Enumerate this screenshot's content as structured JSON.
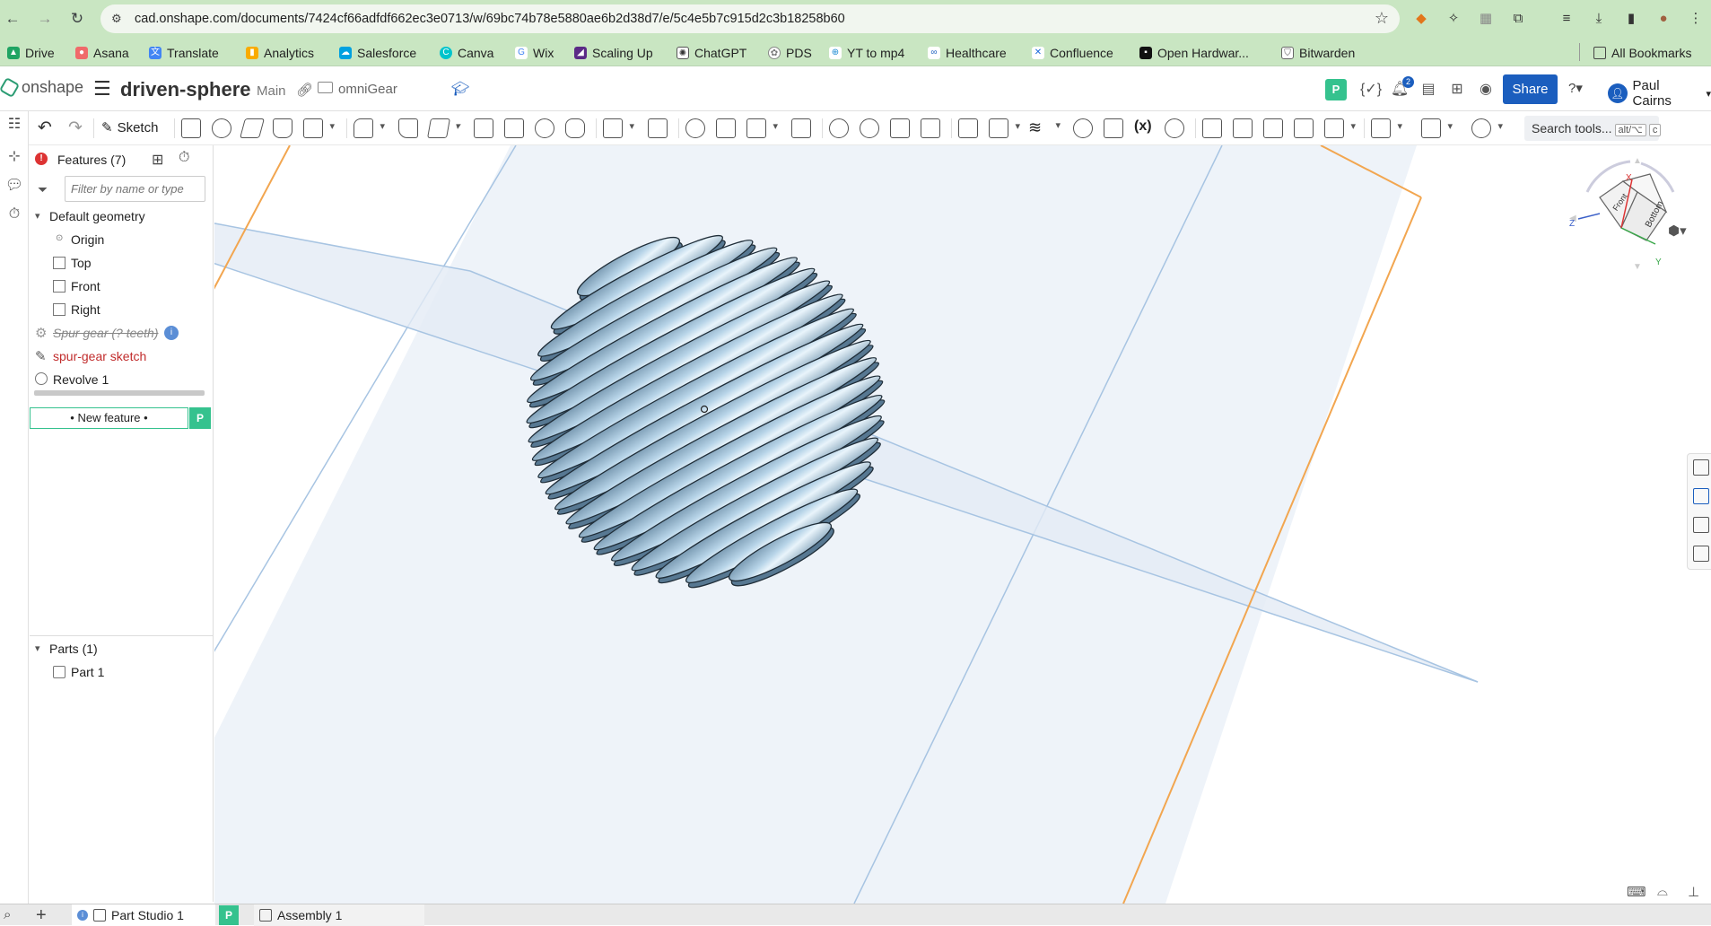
{
  "browser": {
    "url": "cad.onshape.com/documents/7424cf66adfdf662ec3e0713/w/69bc74b78e5880ae6b2d38d7/e/5c4e5b7c915d2c3b18258b60",
    "bookmarks": [
      "Drive",
      "Asana",
      "Translate",
      "Analytics",
      "Salesforce",
      "Canva",
      "Wix",
      "Scaling Up",
      "ChatGPT",
      "PDS",
      "YT to mp4",
      "Healthcare",
      "Confluence",
      "Open Hardwar...",
      "Bitwarden"
    ],
    "all_bookmarks": "All Bookmarks"
  },
  "header": {
    "logo": "onshape",
    "doc_title": "driven-sphere",
    "branch": "Main",
    "folder": "omniGear",
    "badge": "P",
    "notifications": "2",
    "share": "Share",
    "user": "Paul Cairns"
  },
  "toolbar": {
    "sketch_label": "Sketch",
    "search_label": "Search tools...",
    "search_kbd_1": "alt/⌥",
    "search_kbd_2": "c"
  },
  "features": {
    "title": "Features (7)",
    "filter_placeholder": "Filter by name or type",
    "default_geometry": "Default geometry",
    "items": [
      "Origin",
      "Top",
      "Front",
      "Right"
    ],
    "spur_gear": "Spur gear (? teeth)",
    "spur_sketch": "spur-gear sketch",
    "revolve": "Revolve 1",
    "new_feature": "• New feature •",
    "new_feature_badge": "P",
    "parts_header": "Parts (1)",
    "part_1": "Part 1"
  },
  "view_cube": {
    "face_front": "Front",
    "face_bottom": "Bottom",
    "axis_x": "X",
    "axis_y": "Y",
    "axis_z": "Z"
  },
  "tabs": {
    "part_studio": "Part Studio 1",
    "badge": "P",
    "assembly": "Assembly 1"
  },
  "colors": {
    "accent": "#1b5ebe",
    "onshape_green": "#35c28e",
    "error": "#c12c2c",
    "plane_edge": "#a7c4e2",
    "selected_plane": "#f2a650",
    "part": "#8fb6cf"
  }
}
